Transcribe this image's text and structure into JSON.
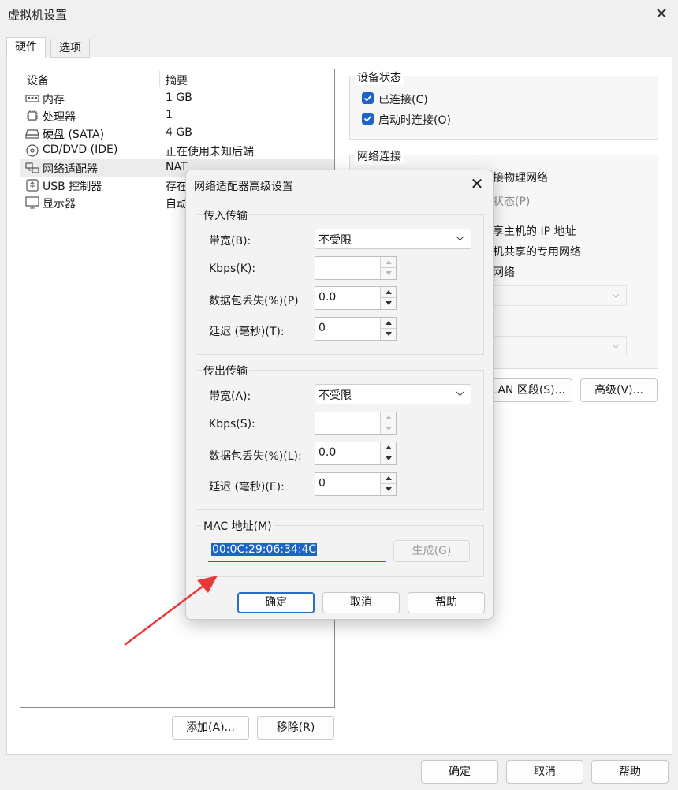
{
  "window": {
    "title": "虚拟机设置",
    "close_glyph": "✕"
  },
  "tabs": [
    {
      "label": "硬件",
      "active": true
    },
    {
      "label": "选项",
      "active": false
    }
  ],
  "device_list": {
    "col_device": "设备",
    "col_summary": "摘要",
    "rows": [
      {
        "name": "内存",
        "summary": "1 GB",
        "icon": "memory-icon"
      },
      {
        "name": "处理器",
        "summary": "1",
        "icon": "processor-icon"
      },
      {
        "name": "硬盘 (SATA)",
        "summary": "4 GB",
        "icon": "harddisk-icon"
      },
      {
        "name": "CD/DVD (IDE)",
        "summary": "正在使用未知后端",
        "icon": "cdrom-icon"
      },
      {
        "name": "网络适配器",
        "summary": "NAT",
        "icon": "network-adapter-icon",
        "selected": true
      },
      {
        "name": "USB 控制器",
        "summary": "存在",
        "icon": "usb-icon"
      },
      {
        "name": "显示器",
        "summary": "自动",
        "icon": "monitor-icon"
      }
    ]
  },
  "device_status": {
    "title": "设备状态",
    "connected": "已连接(C)",
    "connect_at_poweron": "启动时连接(O)"
  },
  "network_connection": {
    "title": "网络连接",
    "bridged_tail": "接物理网络",
    "replicate_tail": "状态(P)",
    "nat_tail": "享主机的 IP 地址",
    "hostonly_tail": "机共享的专用网络",
    "custom_tail": "网络",
    "lan_button_tail": "LAN 区段(S)...",
    "advanced_button": "高级(V)..."
  },
  "left_buttons": {
    "add": "添加(A)...",
    "remove": "移除(R)"
  },
  "bottom_buttons": {
    "ok": "确定",
    "cancel": "取消",
    "help": "帮助"
  },
  "dialog": {
    "title": "网络适配器高级设置",
    "incoming": {
      "title": "传入传输",
      "bandwidth_label": "带宽(B):",
      "bandwidth_value": "不受限",
      "kbps_label": "Kbps(K):",
      "kbps_value": "",
      "loss_label": "数据包丢失(%)(P)",
      "loss_value": "0.0",
      "latency_label": "延迟 (毫秒)(T):",
      "latency_value": "0"
    },
    "outgoing": {
      "title": "传出传输",
      "bandwidth_label": "带宽(A):",
      "bandwidth_value": "不受限",
      "kbps_label": "Kbps(S):",
      "kbps_value": "",
      "loss_label": "数据包丢失(%)(L):",
      "loss_value": "0.0",
      "latency_label": "延迟 (毫秒)(E):",
      "latency_value": "0"
    },
    "mac": {
      "title": "MAC 地址(M)",
      "value": "00:0C:29:06:34:4C",
      "generate": "生成(G)"
    },
    "buttons": {
      "ok": "确定",
      "cancel": "取消",
      "help": "帮助"
    }
  },
  "colors": {
    "accent": "#1b64c8",
    "annotation_arrow": "#e8383a"
  }
}
